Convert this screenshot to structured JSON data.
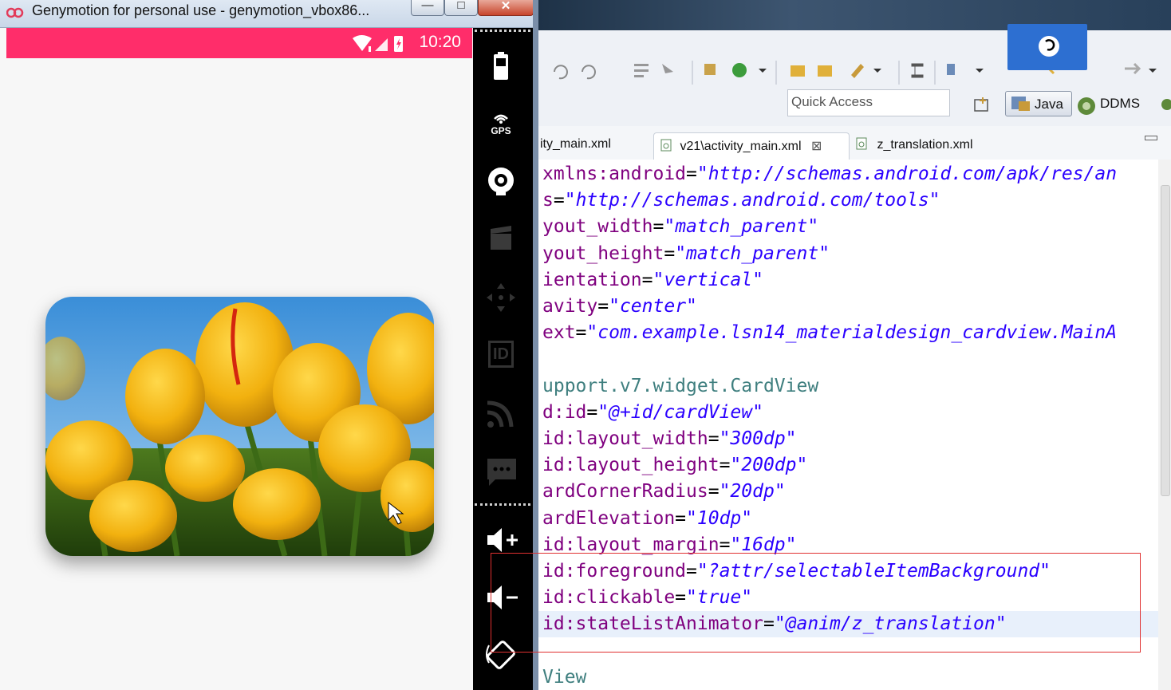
{
  "genymotion": {
    "title": "Genymotion for personal use - genymotion_vbox86...",
    "window_buttons": {
      "minimize": "—",
      "maximize": "□",
      "close": "✕"
    },
    "status_bar": {
      "time": "10:20",
      "color": "#ff2d6a",
      "icons": [
        "wifi-icon",
        "signal-icon",
        "battery-charging-icon"
      ]
    },
    "card": {
      "image": "yellow tulips under blue sky",
      "corner": "rounded"
    },
    "side_toolbar": {
      "items": [
        "battery-icon",
        "gps-icon",
        "camera-icon",
        "video-capture-icon",
        "dpad-icon",
        "device-id-icon",
        "network-icon",
        "sms-icon",
        "volume-up-icon",
        "volume-down-icon",
        "rotate-icon"
      ],
      "gps_label": "GPS",
      "id_label": "ID"
    }
  },
  "eclipse": {
    "quick_access": {
      "placeholder": "Quick Access"
    },
    "perspectives": {
      "java": "Java",
      "ddms": "DDMS"
    },
    "tabs": [
      {
        "label": "ity_main.xml",
        "active": false
      },
      {
        "label": "v21\\activity_main.xml",
        "active": true
      },
      {
        "label": "z_translation.xml",
        "active": false
      }
    ],
    "code_lines": [
      {
        "attr": "xmlns:android",
        "eq": "=",
        "val": "\"http://schemas.android.com/apk/res/an"
      },
      {
        "attr": "s",
        "eq": "=",
        "val": "\"http://schemas.android.com/tools\""
      },
      {
        "attr": "yout_width",
        "eq": "=",
        "val": "\"match_parent\""
      },
      {
        "attr": "yout_height",
        "eq": "=",
        "val": "\"match_parent\""
      },
      {
        "attr": "ientation",
        "eq": "=",
        "val": "\"vertical\""
      },
      {
        "attr": "avity",
        "eq": "=",
        "val": "\"center\""
      },
      {
        "attr": "ext",
        "eq": "=",
        "val": "\"com.example.lsn14_materialdesign_cardview.MainA"
      },
      {
        "tag": ""
      },
      {
        "tag": "upport.v7.widget.CardView"
      },
      {
        "attr": "d:id",
        "eq": "=",
        "val": "\"@+id/cardView\""
      },
      {
        "attr": "id:layout_width",
        "eq": "=",
        "val": "\"300dp\""
      },
      {
        "attr": "id:layout_height",
        "eq": "=",
        "val": "\"200dp\""
      },
      {
        "attr": "ardCornerRadius",
        "eq": "=",
        "val": "\"20dp\""
      },
      {
        "attr": "ardElevation",
        "eq": "=",
        "val": "\"10dp\""
      },
      {
        "attr": "id:layout_margin",
        "eq": "=",
        "val": "\"16dp\""
      },
      {
        "attr": "id:foreground",
        "eq": "=",
        "val": "\"?attr/selectableItemBackground\""
      },
      {
        "attr": "id:clickable",
        "eq": "=",
        "val": "\"true\""
      },
      {
        "attr": "id:stateListAnimator",
        "eq": "=",
        "val": "\"@anim/z_translation\""
      },
      {
        "tag": ""
      },
      {
        "tag": "View"
      }
    ],
    "current_line": 18,
    "highlight_box_color": "#e03030"
  }
}
